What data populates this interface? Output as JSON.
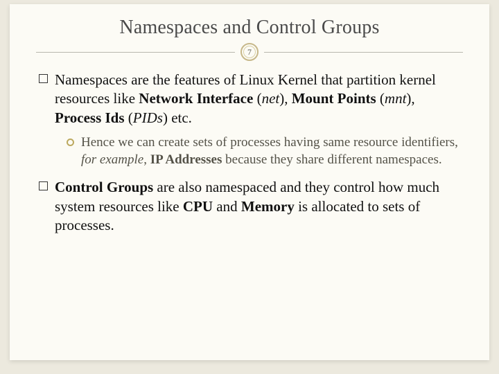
{
  "slide": {
    "title": "Namespaces and Control Groups",
    "page_number": "7",
    "bullets": [
      {
        "level": 1,
        "runs": [
          {
            "t": "Namespaces",
            "b": false,
            "i": false
          },
          {
            "t": " are the features of Linux Kernel that partition kernel resources like ",
            "b": false,
            "i": false
          },
          {
            "t": "Network Interface",
            "b": true,
            "i": false
          },
          {
            "t": " (",
            "b": false,
            "i": false
          },
          {
            "t": "net",
            "b": false,
            "i": true
          },
          {
            "t": "), ",
            "b": false,
            "i": false
          },
          {
            "t": "Mount Points",
            "b": true,
            "i": false
          },
          {
            "t": " (",
            "b": false,
            "i": false
          },
          {
            "t": "mnt",
            "b": false,
            "i": true
          },
          {
            "t": "), ",
            "b": false,
            "i": false
          },
          {
            "t": "Process Ids",
            "b": true,
            "i": false
          },
          {
            "t": " (",
            "b": false,
            "i": false
          },
          {
            "t": "PIDs",
            "b": false,
            "i": true
          },
          {
            "t": ") etc.",
            "b": false,
            "i": false
          }
        ]
      },
      {
        "level": 2,
        "runs": [
          {
            "t": "Hence we can create sets of processes having same resource identifiers, ",
            "b": false,
            "i": false
          },
          {
            "t": "for example",
            "b": false,
            "i": true
          },
          {
            "t": ", ",
            "b": false,
            "i": false
          },
          {
            "t": "IP Addresses",
            "b": true,
            "i": false
          },
          {
            "t": " because they share different namespaces.",
            "b": false,
            "i": false
          }
        ]
      },
      {
        "level": 1,
        "runs": [
          {
            "t": "Control Groups",
            "b": true,
            "i": false
          },
          {
            "t": " are also namespaced and they control how much system resources like ",
            "b": false,
            "i": false
          },
          {
            "t": "CPU",
            "b": true,
            "i": false
          },
          {
            "t": " and ",
            "b": false,
            "i": false
          },
          {
            "t": "Memory",
            "b": true,
            "i": false
          },
          {
            "t": " is allocated to sets of processes.",
            "b": false,
            "i": false
          }
        ]
      }
    ]
  },
  "colors": {
    "background": "#ece9de",
    "slide_bg": "#fcfbf5",
    "accent_ring": "#c7b88a",
    "sub_bullet_text": "#545248"
  }
}
